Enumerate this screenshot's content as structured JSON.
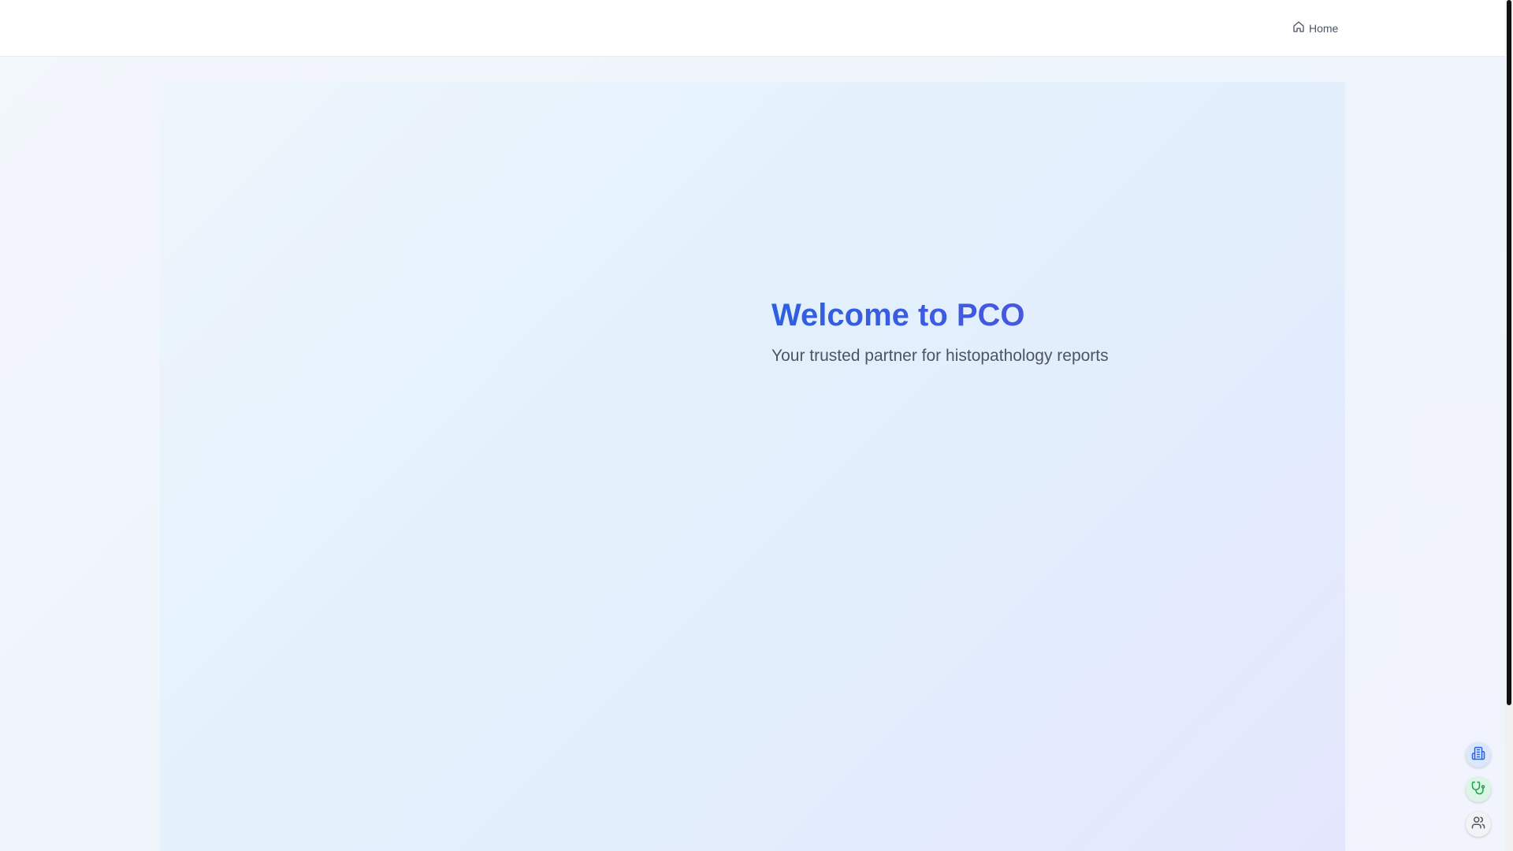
{
  "nav": {
    "home_label": "Home",
    "home_icon": "home-icon"
  },
  "hero": {
    "title": "Welcome to PCO",
    "subtitle": "Your trusted partner for histopathology reports"
  },
  "floating_actions": [
    {
      "icon": "hospital-icon",
      "color": "#2563eb"
    },
    {
      "icon": "stethoscope-icon",
      "color": "#16a34a"
    },
    {
      "icon": "users-icon",
      "color": "#4b5563"
    }
  ],
  "colors": {
    "title_gradient_start": "#2f5fe0",
    "title_gradient_end": "#5a4fe0",
    "subtitle": "#4b5563"
  }
}
